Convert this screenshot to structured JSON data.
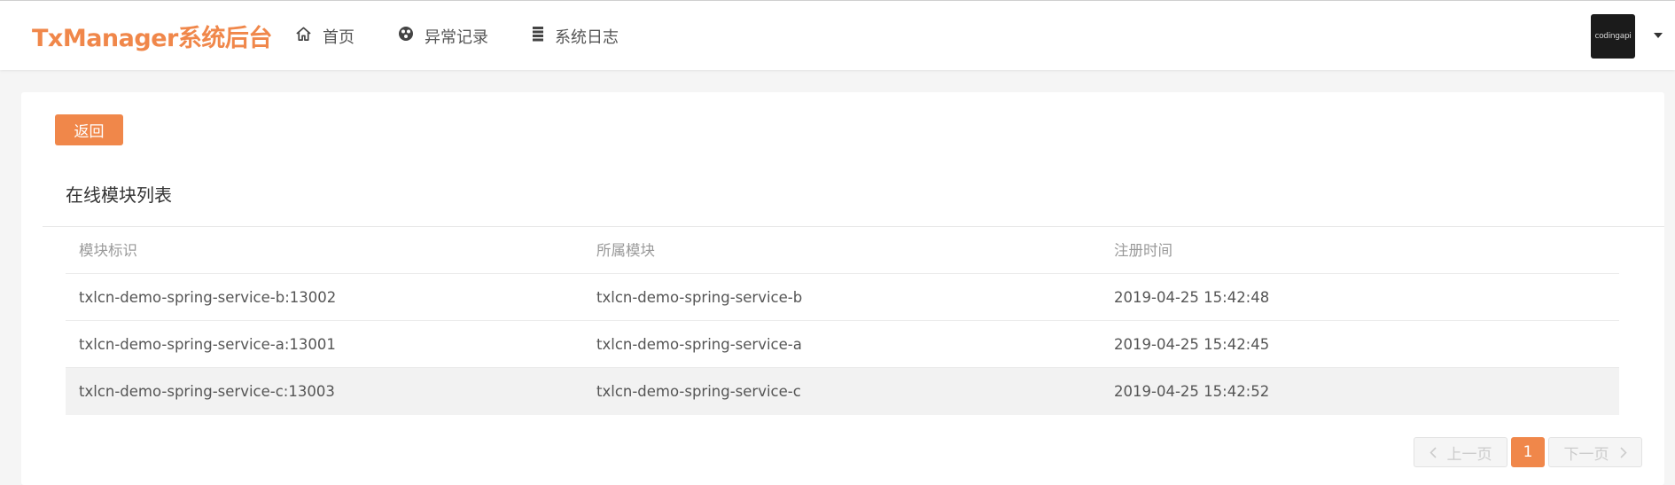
{
  "header": {
    "brand": "TxManager系统后台",
    "nav": [
      {
        "label": "首页",
        "icon": "home-icon"
      },
      {
        "label": "异常记录",
        "icon": "error-log-icon"
      },
      {
        "label": "系统日志",
        "icon": "list-icon"
      }
    ],
    "avatar_text": "codingapi"
  },
  "colors": {
    "accent": "#f0874a",
    "page_bg": "#f5f5f5",
    "highlight_row": "#f2f2f2"
  },
  "main": {
    "back_label": "返回",
    "section_title": "在线模块列表",
    "table": {
      "columns": [
        "模块标识",
        "所属模块",
        "注册时间"
      ],
      "rows": [
        [
          "txlcn-demo-spring-service-b:13002",
          "txlcn-demo-spring-service-b",
          "2019-04-25 15:42:48"
        ],
        [
          "txlcn-demo-spring-service-a:13001",
          "txlcn-demo-spring-service-a",
          "2019-04-25 15:42:45"
        ],
        [
          "txlcn-demo-spring-service-c:13003",
          "txlcn-demo-spring-service-c",
          "2019-04-25 15:42:52"
        ]
      ]
    },
    "pagination": {
      "prev_label": "上一页",
      "current_page": "1",
      "next_label": "下一页"
    }
  }
}
